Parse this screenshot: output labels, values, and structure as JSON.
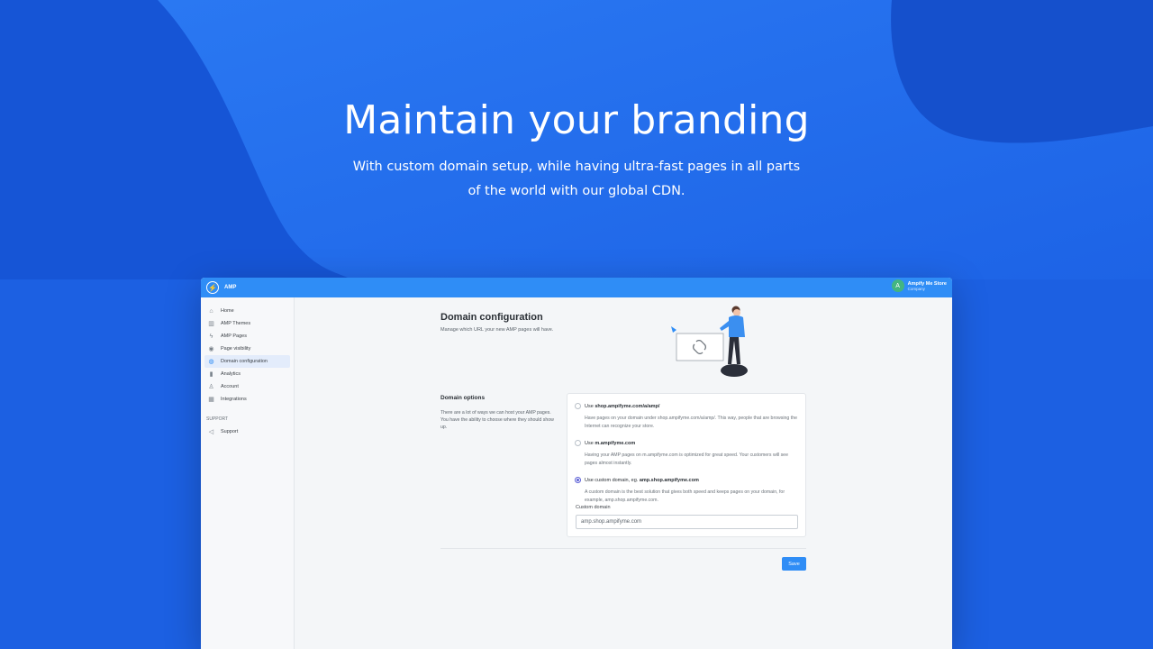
{
  "hero": {
    "title": "Maintain your branding",
    "subtitle": "With custom domain setup, while having ultra-fast pages in all parts of the world with our global CDN."
  },
  "colors": {
    "background": "#1a5fe0",
    "accent": "#2f8df6",
    "radio_selected": "#5b5fd6",
    "avatar": "#43b581"
  },
  "app": {
    "name": "AMP",
    "store": {
      "avatar_letter": "A",
      "name": "Ampify Me Store",
      "role": "Company"
    }
  },
  "sidebar": {
    "items": [
      {
        "label": "Home",
        "icon": "home-icon"
      },
      {
        "label": "AMP Themes",
        "icon": "store-icon"
      },
      {
        "label": "AMP Pages",
        "icon": "bolt-icon"
      },
      {
        "label": "Page visibility",
        "icon": "eye-icon"
      },
      {
        "label": "Domain configuration",
        "icon": "globe-icon",
        "active": true
      },
      {
        "label": "Analytics",
        "icon": "bar-chart-icon"
      },
      {
        "label": "Account",
        "icon": "user-icon"
      },
      {
        "label": "Integrations",
        "icon": "apps-icon"
      }
    ],
    "support_section": "SUPPORT",
    "support_item": {
      "label": "Support",
      "icon": "megaphone-icon"
    }
  },
  "main": {
    "title": "Domain configuration",
    "description": "Manage which URL your new AMP pages will have.",
    "options_title": "Domain options",
    "options_description": "There are a lot of ways we can host your AMP pages. You have the ability to choose where they should show up.",
    "options": [
      {
        "prefix": "Use ",
        "value": "shop.ampifyme.com/a/amp/",
        "help": "Have pages on your domain under shop.ampifyme.com/a/amp/. This way, people that are browsing the Internet can recognize your store.",
        "checked": false
      },
      {
        "prefix": "Use ",
        "value": "m.ampifyme.com",
        "help": "Having your AMP pages on m.ampifyme.com is optimized for great speed. Your customers will see pages almost instantly.",
        "checked": false
      },
      {
        "prefix": "Use custom domain, eg. ",
        "value": "amp.shop.ampifyme.com",
        "help": "A custom domain is the best solution that gives both speed and keeps pages on your domain, for example, amp.shop.ampifyme.com.",
        "checked": true
      }
    ],
    "custom_domain_label": "Custom domain",
    "custom_domain_value": "amp.shop.ampifyme.com",
    "save_label": "Save"
  }
}
